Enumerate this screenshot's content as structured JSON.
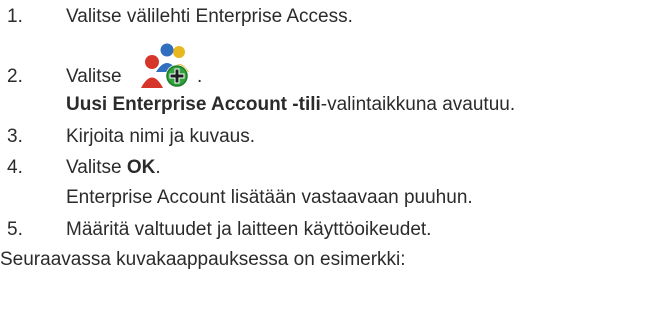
{
  "steps": [
    {
      "num": "1.",
      "text": "Valitse välilehti Enterprise Access."
    },
    {
      "num": "2.",
      "text": "Valitse",
      "suffix": ".",
      "icon": "add-enterprise-account-icon"
    },
    {
      "bold": "Uusi Enterprise Account -tili",
      "rest": "-valintaikkuna avautuu."
    },
    {
      "num": "3.",
      "text": "Kirjoita nimi ja kuvaus."
    },
    {
      "num": "4.",
      "text": "Valitse ",
      "bold": "OK",
      "suffix": "."
    },
    {
      "text": "Enterprise Account lisätään vastaavaan puuhun."
    },
    {
      "num": "5.",
      "text": "Määritä valtuudet ja laitteen käyttöoikeudet."
    }
  ],
  "footer": "Seuraavassa kuvakaappauksessa on esimerkki:",
  "colors": {
    "text": "#2b2b2b",
    "person_red": "#d6362a",
    "person_blue": "#2f6fbd",
    "person_yellow": "#e8b820",
    "plus_green": "#2fa43c"
  }
}
